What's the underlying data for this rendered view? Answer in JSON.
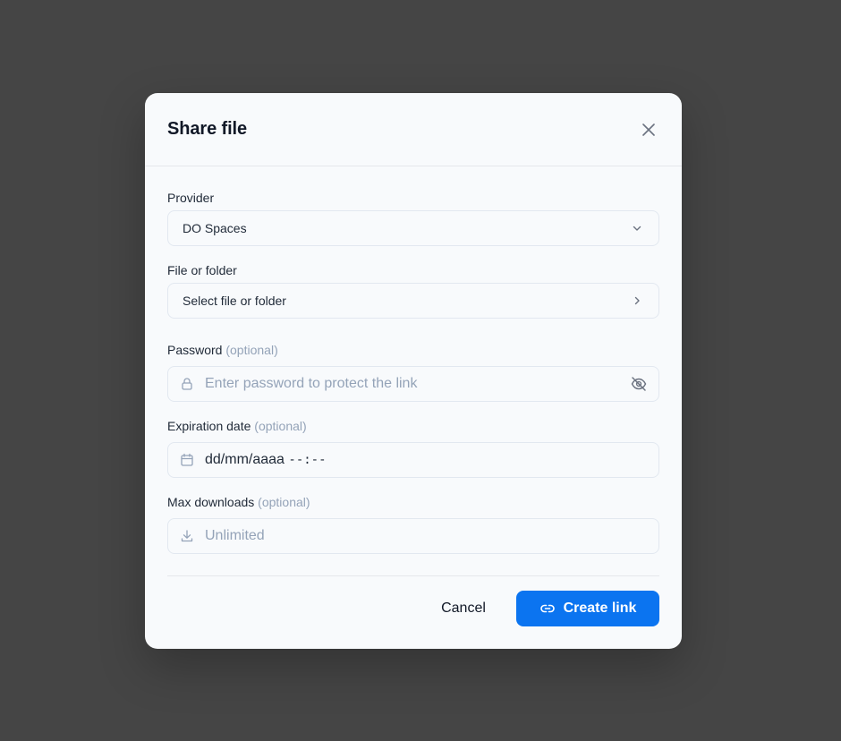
{
  "dialog": {
    "title": "Share file"
  },
  "provider": {
    "label": "Provider",
    "value": "DO Spaces"
  },
  "file": {
    "label": "File or folder",
    "value": "Select file or folder"
  },
  "password": {
    "label": "Password",
    "optional": "(optional)",
    "placeholder": "Enter password to protect the link"
  },
  "expiration": {
    "label": "Expiration date",
    "optional": "(optional)",
    "date_placeholder": "dd/mm/aaaa",
    "time_placeholder": "--:--"
  },
  "max_downloads": {
    "label": "Max downloads",
    "optional": "(optional)",
    "placeholder": "Unlimited"
  },
  "actions": {
    "cancel": "Cancel",
    "create": "Create link"
  },
  "icons": {
    "close": "close-icon",
    "provider_chevron": "chevron-down-icon",
    "file_chevron": "chevron-right-icon",
    "password_lead": "lock-icon",
    "password_toggle": "eye-off-icon",
    "date_lead": "calendar-icon",
    "downloads_lead": "download-icon",
    "create": "link-icon"
  },
  "colors": {
    "overlay": "#454545",
    "modal_bg": "#f8fafc",
    "primary": "#0b74f0",
    "muted": "#94a3b8"
  }
}
